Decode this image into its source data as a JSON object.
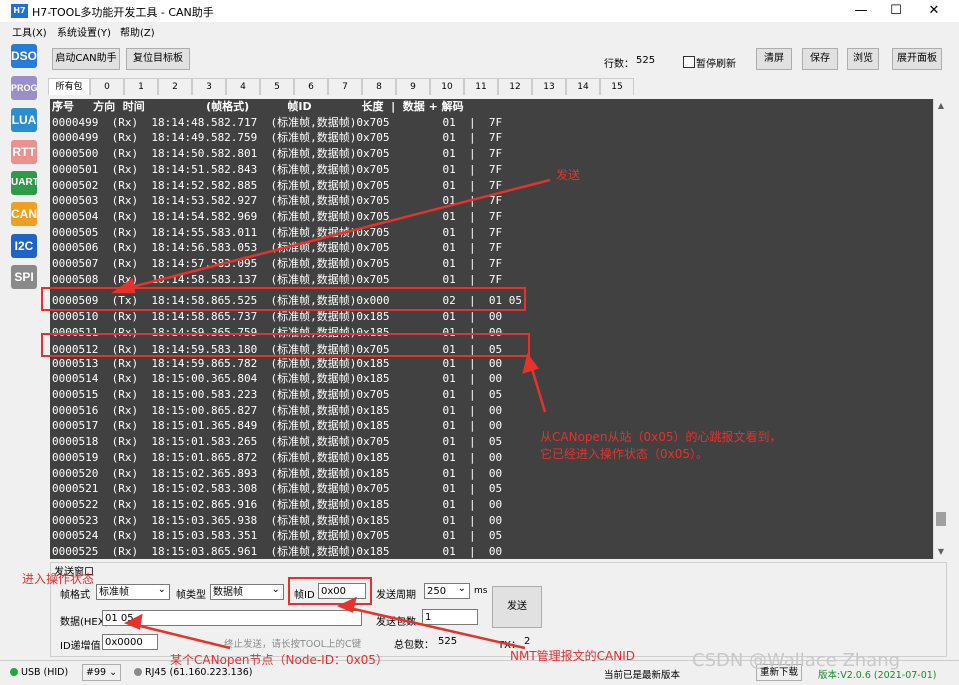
{
  "window": {
    "app_badge": "H7",
    "title": "H7-TOOL多功能开发工具 - CAN助手",
    "min": "—",
    "max": "☐",
    "close": "✕"
  },
  "menu": [
    "工具(X)",
    "系统设置(Y)",
    "帮助(Z)"
  ],
  "sidebar": [
    {
      "label": "DSO",
      "color": "#2a7bd6"
    },
    {
      "label": "PROG",
      "color": "#9a8fc8"
    },
    {
      "label": "LUA",
      "color": "#2b8fcf"
    },
    {
      "label": "RTT",
      "color": "#f08f8f"
    },
    {
      "label": "UART",
      "color": "#2e9a4a"
    },
    {
      "label": "CAN",
      "color": "#f0a020"
    },
    {
      "label": "I2C",
      "color": "#1f63c8"
    },
    {
      "label": "SPI",
      "color": "#8a8a8a"
    }
  ],
  "toolbar": {
    "start_can": "启动CAN助手",
    "reset_target": "复位目标板",
    "row_count_label": "行数：",
    "row_count": "525",
    "pause_refresh": "暂停刷新",
    "clear": "清屏",
    "save": "保存",
    "browse": "浏览",
    "expand": "展开面板"
  },
  "tabs": [
    "所有包",
    "0",
    "1",
    "2",
    "3",
    "4",
    "5",
    "6",
    "7",
    "8",
    "9",
    "10",
    "11",
    "12",
    "13",
    "14",
    "15"
  ],
  "console": {
    "header": "序号     方向  时间                (帧格式)          帧ID             长度  |  数据 + 解码",
    "rows": [
      "0000499  (Rx)  18:14:48.582.717  (标准帧,数据帧)0x705        01  |  7F",
      "0000499  (Rx)  18:14:49.582.759  (标准帧,数据帧)0x705        01  |  7F",
      "0000500  (Rx)  18:14:50.582.801  (标准帧,数据帧)0x705        01  |  7F",
      "0000501  (Rx)  18:14:51.582.843  (标准帧,数据帧)0x705        01  |  7F",
      "0000502  (Rx)  18:14:52.582.885  (标准帧,数据帧)0x705        01  |  7F",
      "0000503  (Rx)  18:14:53.582.927  (标准帧,数据帧)0x705        01  |  7F",
      "0000504  (Rx)  18:14:54.582.969  (标准帧,数据帧)0x705        01  |  7F",
      "0000505  (Rx)  18:14:55.583.011  (标准帧,数据帧)0x705        01  |  7F",
      "0000506  (Rx)  18:14:56.583.053  (标准帧,数据帧)0x705        01  |  7F",
      "0000507  (Rx)  18:14:57.583.095  (标准帧,数据帧)0x705        01  |  7F",
      "0000508  (Rx)  18:14:58.583.137  (标准帧,数据帧)0x705        01  |  7F",
      "0000509  (Tx)  18:14:58.865.525  (标准帧,数据帧)0x000        02  |  01 05",
      "0000510  (Rx)  18:14:58.865.737  (标准帧,数据帧)0x185        01  |  00",
      "0000511  (Rx)  18:14:59.365.759  (标准帧,数据帧)0x185        01  |  00",
      "0000512  (Rx)  18:14:59.583.180  (标准帧,数据帧)0x705        01  |  05",
      "0000513  (Rx)  18:14:59.865.782  (标准帧,数据帧)0x185        01  |  00",
      "0000514  (Rx)  18:15:00.365.804  (标准帧,数据帧)0x185        01  |  00",
      "0000515  (Rx)  18:15:00.583.223  (标准帧,数据帧)0x705        01  |  05",
      "0000516  (Rx)  18:15:00.865.827  (标准帧,数据帧)0x185        01  |  00",
      "0000517  (Rx)  18:15:01.365.849  (标准帧,数据帧)0x185        01  |  00",
      "0000518  (Rx)  18:15:01.583.265  (标准帧,数据帧)0x705        01  |  05",
      "0000519  (Rx)  18:15:01.865.872  (标准帧,数据帧)0x185        01  |  00",
      "0000520  (Rx)  18:15:02.365.893  (标准帧,数据帧)0x185        01  |  00",
      "0000521  (Rx)  18:15:02.583.308  (标准帧,数据帧)0x705        01  |  05",
      "0000522  (Rx)  18:15:02.865.916  (标准帧,数据帧)0x185        01  |  00",
      "0000523  (Rx)  18:15:03.365.938  (标准帧,数据帧)0x185        01  |  00",
      "0000524  (Rx)  18:15:03.583.351  (标准帧,数据帧)0x705        01  |  05",
      "0000525  (Rx)  18:15:03.865.961  (标准帧,数据帧)0x185        01  |  00"
    ]
  },
  "send": {
    "panel_title": "发送窗口",
    "frame_format_label": "帧格式",
    "frame_format_value": "标准帧",
    "frame_type_label": "帧类型",
    "frame_type_value": "数据帧",
    "frame_id_label": "帧ID",
    "frame_id_value": "0x00",
    "period_label": "发送周期",
    "period_value": "250",
    "period_unit": "ms",
    "data_label": "数据(HEX)",
    "data_value": "01 05",
    "send_count_label": "发送包数",
    "send_count_value": "1",
    "send_button": "发送",
    "id_inc_label": "ID递增值",
    "id_inc_value": "0x0000",
    "hint": "终止发送，请长按TOOL上的C键",
    "total_label": "总包数：",
    "total_value": "525",
    "tx_label": "TX：",
    "tx_value": "2"
  },
  "status": {
    "usb": "USB (HID)",
    "port": "#99",
    "rj45": "RJ45 (61.160.223.136)",
    "latest": "当前已是最新版本",
    "redownload": "重新下载",
    "version": "版本:V2.0.6 (2021-07-01)",
    "watermark": "CSDN @Wallace Zhang",
    "usb_color": "#1faa3b",
    "rj45_color": "#8a8a8a"
  },
  "annotations": {
    "send": "发送",
    "heartbeat_line1": "从CANopen从站（0x05）的心跳报文看到，",
    "heartbeat_line2": "它已经进入操作状态（0x05）。",
    "enter_op": "进入操作状态",
    "node": "某个CANopen节点（Node-ID：0x05）",
    "nmt": "NMT管理报文的CANID",
    "color": "#e5322d"
  }
}
